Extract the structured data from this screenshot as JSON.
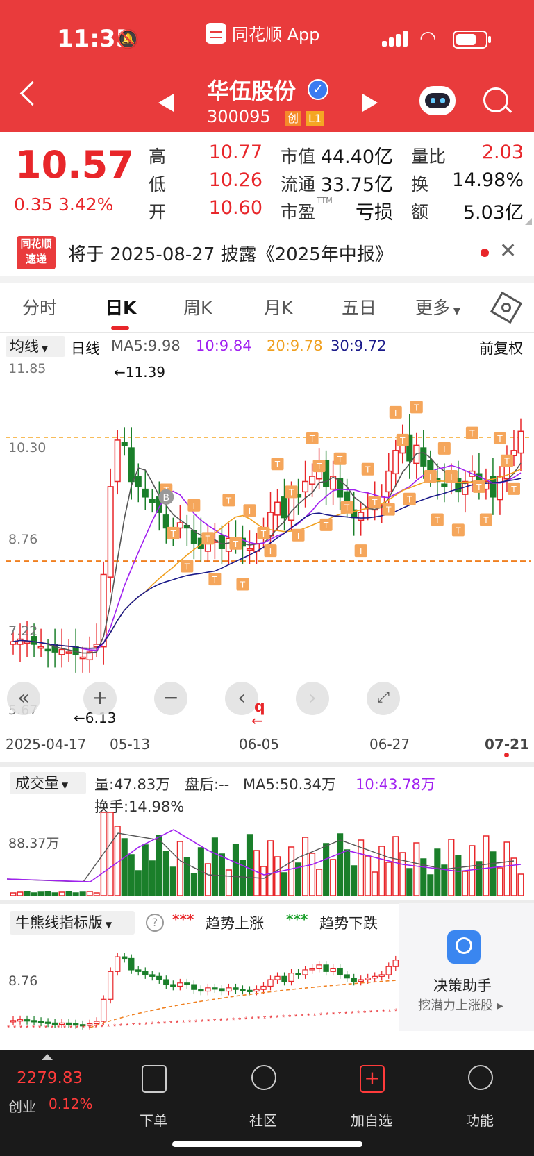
{
  "status_bar": {
    "time": "11:35",
    "app_name": "同花顺 App"
  },
  "header": {
    "stock_name": "华伍股份",
    "stock_code": "300095",
    "tags": [
      "创",
      "L1"
    ]
  },
  "quote": {
    "price": "10.57",
    "change": "0.35",
    "change_pct": "3.42%",
    "fields": [
      {
        "label": "高",
        "value": "10.77"
      },
      {
        "label": "低",
        "value": "10.26"
      },
      {
        "label": "开",
        "value": "10.60"
      },
      {
        "label": "市值",
        "value": "44.40亿"
      },
      {
        "label": "流通",
        "value": "33.75亿"
      },
      {
        "label": "市盈",
        "sup": "TTM",
        "value": "亏损"
      },
      {
        "label": "量比",
        "value": "2.03"
      },
      {
        "label": "换",
        "value": "14.98%"
      },
      {
        "label": "额",
        "value": "5.03亿"
      }
    ]
  },
  "notice": {
    "logo_top": "同花顺",
    "logo_bottom": "速递",
    "text": "将于 2025-08-27 披露《2025年中报》"
  },
  "tabs": [
    "分时",
    "日K",
    "周K",
    "月K",
    "五日",
    "更多"
  ],
  "active_tab": "日K",
  "kline": {
    "indicator_btn": "均线",
    "period": "日线",
    "ma5": "MA5:9.98",
    "ma10": "10:9.84",
    "ma20": "20:9.78",
    "ma30": "30:9.72",
    "adjust": "前复权",
    "y_labels": [
      "11.85",
      "10.30",
      "8.76",
      "7.22",
      "5.67"
    ],
    "max_annot": "←11.39",
    "min_annot": "←6.13",
    "x_labels": [
      "2025-04-17",
      "05-13",
      "06-05",
      "06-27",
      "07-21"
    ],
    "marker_b": "B",
    "marker_t": "T",
    "marker_q": "q"
  },
  "volume": {
    "btn": "成交量",
    "vol": "量:47.83万",
    "after": "盘后:--",
    "ma5": "MA5:50.34万",
    "ma10": "10:43.78万",
    "turnover": "换手:14.98%",
    "y_label": "88.37万"
  },
  "indicator": {
    "btn": "牛熊线指标版",
    "up_label": "趋势上涨",
    "down_label": "趋势下跌",
    "y_label": "8.76",
    "assistant_title": "决策助手",
    "assistant_sub": "挖潜力上涨股 ▸"
  },
  "bottom_bar": {
    "index_value": "2279.83",
    "index_name": "创业",
    "index_pct": "0.12%",
    "items": [
      "下单",
      "社区",
      "加自选",
      "功能"
    ]
  },
  "colors": {
    "header_bg": "#e93b3c",
    "up": "#e8262a",
    "down": "#1a7f2a",
    "ma5": "#555555",
    "ma10": "#a020f0",
    "ma20": "#f0a020",
    "ma30": "#1a1a8a"
  }
}
